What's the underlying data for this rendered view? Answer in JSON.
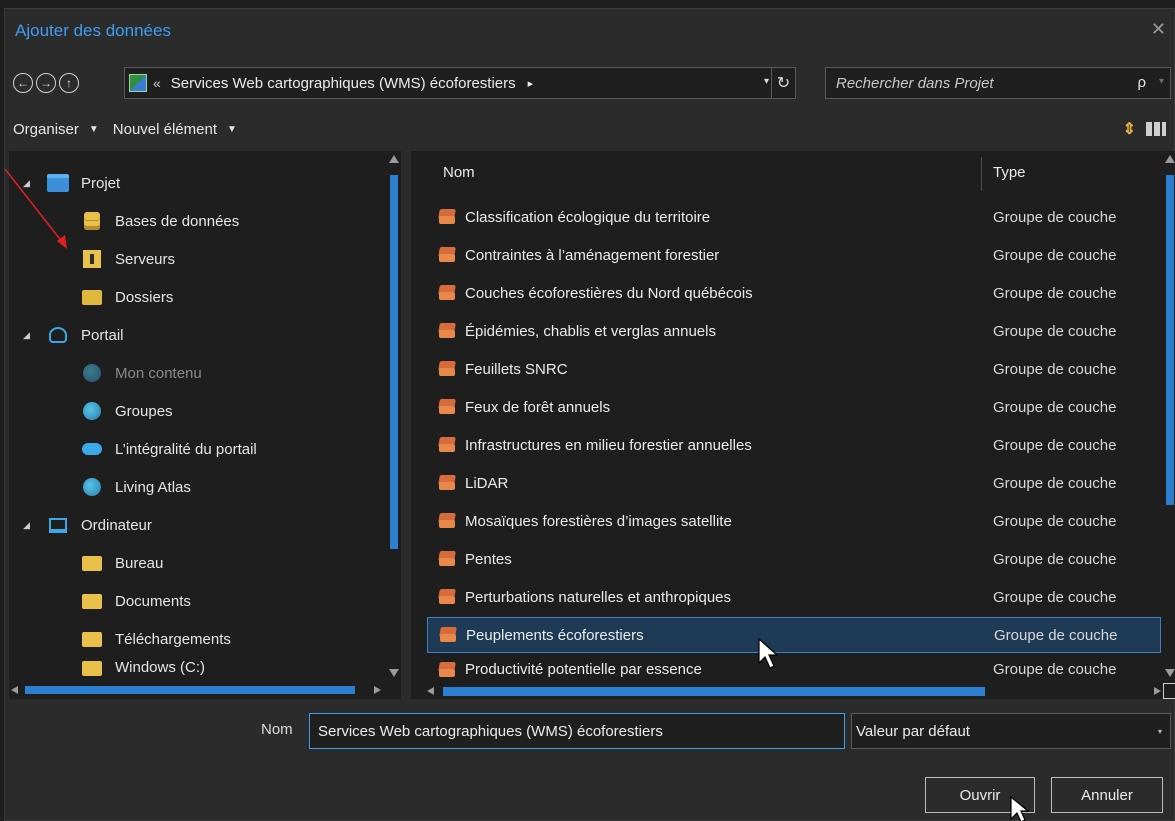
{
  "window": {
    "title": "Ajouter des données",
    "close_icon": "close-icon"
  },
  "nav": {
    "back_icon": "back-arrow-icon",
    "forward_icon": "forward-arrow-icon",
    "up_icon": "up-arrow-icon",
    "path_chevron": "«",
    "path_text": "Services Web cartographiques (WMS) écoforestiers",
    "path_arrow": "▸",
    "path_dropdown": "▾",
    "refresh": "↻"
  },
  "search": {
    "placeholder": "Rechercher dans Projet",
    "icon": "ρ",
    "dropdown": "▾"
  },
  "toolbar": {
    "organise": "Organiser",
    "new_item": "Nouvel élément",
    "caret": "▼"
  },
  "tree": [
    {
      "label": "Projet",
      "toggle": "◢"
    },
    {
      "label": "Bases de données"
    },
    {
      "label": "Serveurs"
    },
    {
      "label": "Dossiers"
    },
    {
      "label": "Portail",
      "toggle": "◢"
    },
    {
      "label": "Mon contenu"
    },
    {
      "label": "Groupes"
    },
    {
      "label": "L’intégralité du portail"
    },
    {
      "label": "Living Atlas"
    },
    {
      "label": "Ordinateur",
      "toggle": "◢"
    },
    {
      "label": "Bureau"
    },
    {
      "label": "Documents"
    },
    {
      "label": "Téléchargements"
    },
    {
      "label": "Windows (C:)"
    }
  ],
  "list": {
    "col_name": "Nom",
    "col_type": "Type",
    "rows": [
      {
        "name": "Classification écologique du territoire",
        "type": "Groupe de couche"
      },
      {
        "name": "Contraintes à l’aménagement forestier",
        "type": "Groupe de couche"
      },
      {
        "name": "Couches écoforestières du Nord québécois",
        "type": "Groupe de couche"
      },
      {
        "name": "Épidémies, chablis et verglas annuels",
        "type": "Groupe de couche"
      },
      {
        "name": "Feuillets SNRC",
        "type": "Groupe de couche"
      },
      {
        "name": "Feux de forêt annuels",
        "type": "Groupe de couche"
      },
      {
        "name": "Infrastructures en milieu forestier annuelles",
        "type": "Groupe de couche"
      },
      {
        "name": "LiDAR",
        "type": "Groupe de couche"
      },
      {
        "name": "Mosaïques forestières d’images satellite",
        "type": "Groupe de couche"
      },
      {
        "name": "Pentes",
        "type": "Groupe de couche"
      },
      {
        "name": "Perturbations naturelles et anthropiques",
        "type": "Groupe de couche"
      },
      {
        "name": "Peuplements écoforestiers",
        "type": "Groupe de couche",
        "selected": true
      },
      {
        "name": "Productivité potentielle par essence",
        "type": "Groupe de couche"
      }
    ]
  },
  "footer": {
    "name_label": "Nom",
    "name_value": "Services Web cartographiques (WMS) écoforestiers",
    "filter_value": "Valeur par défaut",
    "filter_dropdown": "▾",
    "ok_label": "Ouvrir",
    "cancel_label": "Annuler"
  },
  "colors": {
    "accent": "#3d9df2",
    "selection": "#1e3a55",
    "layer_icon": "#d86b3c",
    "folder": "#e8c04a"
  }
}
